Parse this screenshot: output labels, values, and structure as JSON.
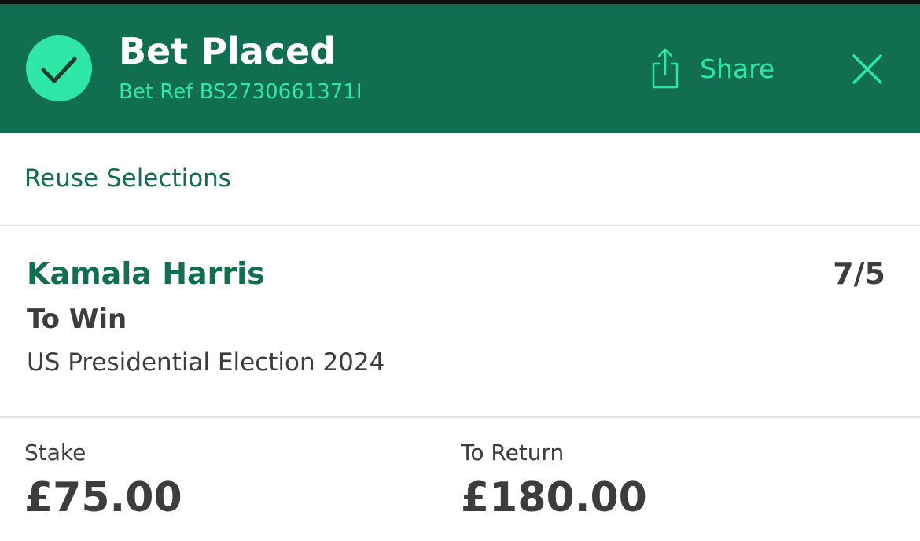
{
  "header": {
    "title": "Bet Placed",
    "bet_ref": "Bet Ref BS2730661371I",
    "share_label": "Share",
    "icons": {
      "status": "check-circle-icon",
      "share": "share-icon",
      "close": "close-icon"
    }
  },
  "actions": {
    "reuse_selections": "Reuse Selections"
  },
  "selection": {
    "name": "Kamala Harris",
    "odds": "7/5",
    "market": "To Win",
    "event": "US Presidential Election 2024"
  },
  "totals": {
    "stake_label": "Stake",
    "stake_value": "£75.00",
    "return_label": "To Return",
    "return_value": "£180.00"
  },
  "colors": {
    "header_bg": "#126e50",
    "accent": "#2ee6a6",
    "brand_text": "#126e50",
    "body_text": "#3d3d3d",
    "divider": "#e2e2e2"
  }
}
